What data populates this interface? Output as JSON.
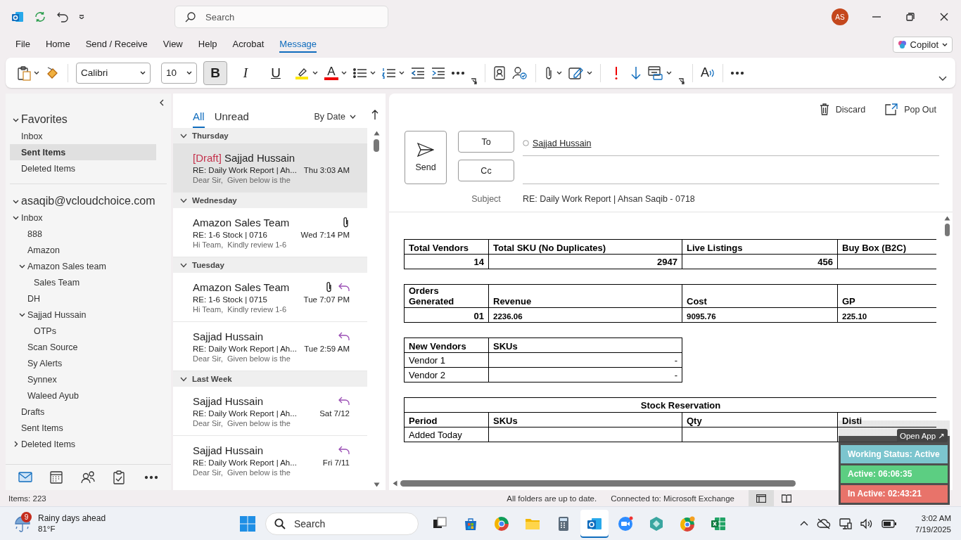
{
  "titlebar": {
    "search": {
      "placeholder": "Search"
    },
    "avatar": "AS"
  },
  "menu_tabs": [
    {
      "label": "File",
      "selected": false
    },
    {
      "label": "Home",
      "selected": false
    },
    {
      "label": "Send / Receive",
      "selected": false
    },
    {
      "label": "View",
      "selected": false
    },
    {
      "label": "Help",
      "selected": false
    },
    {
      "label": "Acrobat",
      "selected": false
    },
    {
      "label": "Message",
      "selected": true
    }
  ],
  "copilot": {
    "label": "Copilot"
  },
  "ribbon": {
    "font": "Calibri",
    "size": "10",
    "format_buttons": [
      {
        "label": "B",
        "selected": true
      },
      {
        "label": "I",
        "selected": false
      },
      {
        "label": "U",
        "selected": false
      }
    ],
    "font_color_label": "A",
    "read_aloud_label": "A"
  },
  "folders": {
    "favorites": {
      "title": "Favorites",
      "expanded": true,
      "items": [
        {
          "label": "Inbox",
          "selected": false
        },
        {
          "label": "Sent Items",
          "selected": true
        },
        {
          "label": "Deleted Items",
          "selected": false
        }
      ]
    },
    "account": {
      "title": "asaqib@vcloudchoice.com",
      "expanded": true,
      "items": [
        {
          "label": "Inbox",
          "selected": false,
          "expanded": true,
          "children": [
            {
              "label": "888",
              "selected": false
            },
            {
              "label": "Amazon",
              "selected": false
            },
            {
              "label": "Amazon Sales team",
              "selected": false,
              "expanded": true,
              "children": [
                {
                  "label": "Sales Team",
                  "selected": false
                }
              ]
            },
            {
              "label": "DH",
              "selected": false
            },
            {
              "label": "Sajjad Hussain",
              "selected": false,
              "expanded": true,
              "children": [
                {
                  "label": "OTPs",
                  "selected": false
                }
              ]
            },
            {
              "label": "Scan Source",
              "selected": false
            },
            {
              "label": "Sy Alerts",
              "selected": false
            },
            {
              "label": "Synnex",
              "selected": false
            },
            {
              "label": "Waleed Ayub",
              "selected": false
            }
          ]
        },
        {
          "label": "Drafts",
          "selected": false
        },
        {
          "label": "Sent Items",
          "selected": false
        },
        {
          "label": "Deleted Items",
          "selected": false,
          "expanded": false
        }
      ]
    },
    "nav": [
      {
        "selected": true
      },
      {
        "selected": false
      },
      {
        "selected": false
      },
      {
        "selected": false
      },
      {
        "selected": false
      }
    ]
  },
  "mail_list": {
    "filters": [
      {
        "label": "All",
        "selected": true
      },
      {
        "label": "Unread",
        "selected": false
      }
    ],
    "sort": "By Date",
    "groups": [
      {
        "title": "Thursday",
        "expanded": true,
        "items": [
          {
            "draft_label": "[Draft]",
            "sender": "Sajjad Hussain",
            "subject": "RE: Daily Work Report | Ah...",
            "preview": "Dear Sir,  Given below is the",
            "time": "Thu 3:03 AM",
            "attachment": false,
            "replied": false,
            "selected": true
          }
        ]
      },
      {
        "title": "Wednesday",
        "expanded": true,
        "items": [
          {
            "sender": "Amazon Sales Team",
            "subject": "RE: 1-6 Stock | 0716",
            "preview": "Hi Team,  Kindly review 1-6",
            "time": "Wed 7:14 PM",
            "attachment": true,
            "replied": false,
            "selected": false
          }
        ]
      },
      {
        "title": "Tuesday",
        "expanded": true,
        "items": [
          {
            "sender": "Amazon Sales Team",
            "subject": "RE: 1-6 Stock | 0715",
            "preview": "Hi Team,  Kindly review 1-6",
            "time": "Tue 7:07 PM",
            "attachment": true,
            "replied": true,
            "selected": false
          },
          {
            "sender": "Sajjad Hussain",
            "subject": "RE: Daily Work Report | Ah...",
            "preview": "Dear Sir,  Given below is the",
            "time": "Tue 2:59 AM",
            "attachment": false,
            "replied": true,
            "selected": false
          }
        ]
      },
      {
        "title": "Last Week",
        "expanded": true,
        "items": [
          {
            "sender": "Sajjad Hussain",
            "subject": "RE: Daily Work Report | Ah...",
            "preview": "Dear Sir,  Given below is the",
            "time": "Sat 7/12",
            "attachment": false,
            "replied": true,
            "selected": false
          },
          {
            "sender": "Sajjad Hussain",
            "subject": "RE: Daily Work Report | Ah...",
            "preview": "Dear Sir,  Given below is the",
            "time": "Fri 7/11",
            "attachment": false,
            "replied": true,
            "selected": false
          }
        ]
      }
    ]
  },
  "compose": {
    "discard": "Discard",
    "pop_out": "Pop Out",
    "send": "Send",
    "to_label": "To",
    "cc_label": "Cc",
    "recipients": [
      "Sajjad Hussain"
    ],
    "subject_label": "Subject",
    "subject": "RE: Daily Work Report | Ahsan Saqib - 0718",
    "tables": [
      {
        "rows": [
          {
            "kind": "header",
            "cells": [
              "Total Vendors",
              "Total SKU (No Duplicates)",
              "Live Listings",
              "Buy Box (B2C)"
            ]
          },
          {
            "kind": "figures",
            "cells": [
              "14",
              "2947",
              "456"
            ]
          }
        ]
      },
      {
        "rows": [
          {
            "kind": "header",
            "cells": [
              "Orders Generated",
              "Revenue",
              "Cost",
              "GP"
            ]
          },
          {
            "kind": "amounts",
            "cells": [
              "01",
              "2236.06",
              "9095.76",
              "225.10"
            ]
          }
        ]
      },
      {
        "rows": [
          {
            "kind": "header",
            "cells": [
              "New Vendors",
              "SKUs"
            ]
          },
          {
            "kind": "entry",
            "cells": [
              "Vendor 1",
              "-"
            ]
          },
          {
            "kind": "entry",
            "cells": [
              "Vendor 2",
              "-"
            ]
          }
        ]
      },
      {
        "rows": [
          {
            "kind": "title",
            "cells": [
              {
                "text": "Stock Reservation",
                "colspan": 4
              }
            ]
          },
          {
            "kind": "header",
            "cells": [
              "Period",
              "SKUs",
              "Qty",
              "Disti"
            ]
          },
          {
            "kind": "entry",
            "cells": [
              "Added Today"
            ]
          }
        ]
      }
    ]
  },
  "tracker": {
    "open_app": "Open App ↗",
    "statuses": [
      {
        "label": "Working Status: Active",
        "color": "#7cc5ce"
      },
      {
        "label": "Active: 06:06:35",
        "color": "#5cce82"
      },
      {
        "label": "In Active: 02:43:21",
        "color": "#e8736a"
      }
    ]
  },
  "status_bar": {
    "items": "Items: 223",
    "sync": "All folders are up to date.",
    "connection": "Connected to: Microsoft Exchange"
  },
  "taskbar": {
    "weather": {
      "badge": "9",
      "title": "Rainy days ahead",
      "temperature": "81°F"
    },
    "search": {
      "placeholder": "Search"
    },
    "apps": [
      {
        "selected": false
      },
      {
        "selected": false
      },
      {
        "selected": false
      },
      {
        "selected": false
      },
      {
        "selected": false
      },
      {
        "selected": true
      },
      {
        "selected": false
      },
      {
        "selected": false
      },
      {
        "selected": false
      },
      {
        "selected": false
      }
    ],
    "time": "3:02 AM",
    "date": "7/19/2025"
  }
}
